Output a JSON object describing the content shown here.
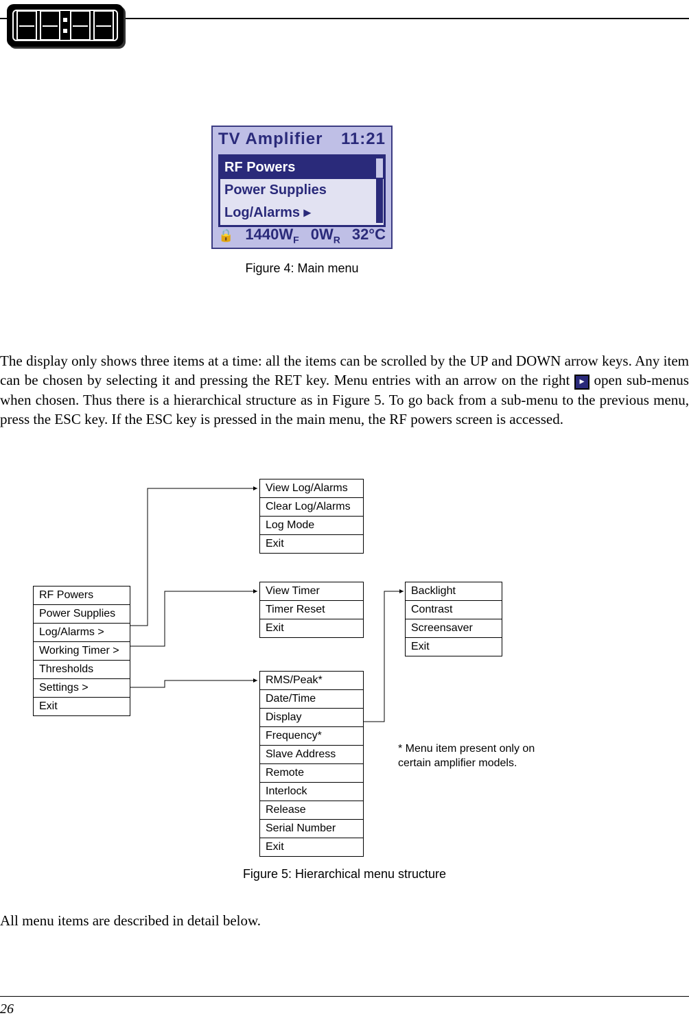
{
  "lcd": {
    "title": "TV Amplifier",
    "clock": "11:21",
    "rows": [
      "RF Powers",
      "Power Supplies",
      "Log/Alarms ▸"
    ],
    "forward_power": "1440W",
    "forward_suffix": "F",
    "reflected_power": "0W",
    "reflected_suffix": "R",
    "temperature": "32°C"
  },
  "captions": {
    "fig4": "Figure 4: Main menu",
    "fig5": "Figure 5: Hierarchical menu structure"
  },
  "body": {
    "para1a": "The display only shows three items at a time: all the items can be scrolled by the UP and DOWN arrow keys. Any item can be chosen by selecting it and pressing the RET key. Menu entries with an arrow on the right ",
    "para1b": " open sub-menus when chosen. Thus there is a hierarchical structure as in Figure 5. To go back from a sub-menu to the previous menu, press the ESC key. If the ESC key is pressed in the main menu, the RF powers screen is accessed.",
    "closing": "All menu items are described in detail below."
  },
  "menus": {
    "main": [
      "RF Powers",
      "Power Supplies",
      "Log/Alarms >",
      "Working Timer >",
      "Thresholds",
      "Settings >",
      "Exit"
    ],
    "log": [
      "View Log/Alarms",
      "Clear Log/Alarms",
      "Log Mode",
      "Exit"
    ],
    "timer": [
      "View Timer",
      "Timer Reset",
      "Exit"
    ],
    "settings": [
      "RMS/Peak*",
      "Date/Time",
      "Display",
      "Frequency*",
      "Slave Address",
      "Remote",
      "Interlock",
      "Release",
      "Serial Number",
      "Exit"
    ],
    "display": [
      "Backlight",
      "Contrast",
      "Screensaver",
      "Exit"
    ]
  },
  "footnote": "* Menu item present only on certain amplifier models.",
  "page_number": "26"
}
